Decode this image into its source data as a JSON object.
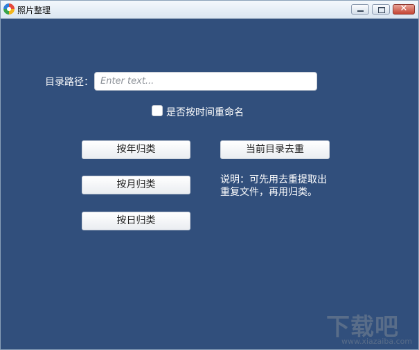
{
  "window": {
    "title": "照片整理",
    "icon": "colorful-app-icon"
  },
  "form": {
    "path_label": "目录路径：",
    "path_value": "",
    "path_placeholder": "Enter text...",
    "rename_checkbox_label": "是否按时间重命名",
    "rename_checked": false
  },
  "buttons": {
    "by_year": "按年归类",
    "by_month": "按月归类",
    "by_day": "按日归类",
    "dedupe": "当前目录去重"
  },
  "note": {
    "line1": "说明：可先用去重提取出",
    "line2": "重复文件，再用归类。"
  },
  "watermark": {
    "main": "下载吧",
    "sub": "www.xiazaiba.com"
  },
  "colors": {
    "background": "#314f7c",
    "button": "#f3f4f6",
    "text": "#ffffff"
  }
}
